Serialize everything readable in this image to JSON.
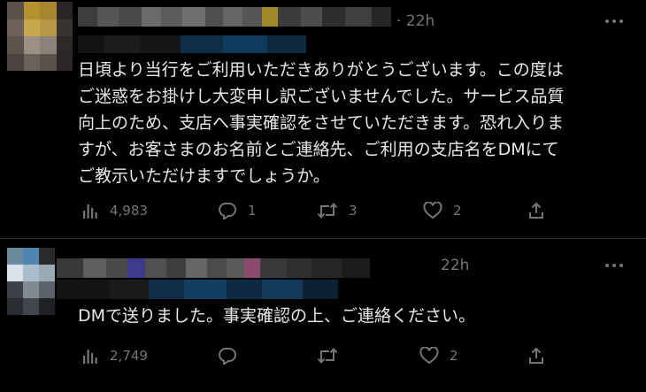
{
  "tweets": [
    {
      "timestamp": "· 22h",
      "text": "日頃より当行をご利用いただきありがとうございます。この度は\nご迷惑をお掛けし大変申し訳ございませんでした。サービス品質\n向上のため、支店へ事実確認をさせていただきます。恐れ入りま\nすが、お客さまのお名前とご連絡先、ご利用の支店名をDMにて\nご教示いただけますでしょうか。",
      "views": "4,983",
      "replies": "1",
      "retweets": "3",
      "likes": "2"
    },
    {
      "timestamp": "22h",
      "text": "DMで送りました。事実確認の上、ご連絡ください。",
      "views": "2,749",
      "replies": "",
      "retweets": "",
      "likes": "2"
    }
  ],
  "icons": {
    "views": "bar-chart-icon",
    "reply": "reply-bubble-icon",
    "retweet": "retweet-icon",
    "like": "heart-icon",
    "share": "share-icon",
    "more": "more-dots-icon"
  },
  "colors": {
    "background": "#000000",
    "text": "#e7e9ea",
    "muted": "#71767b",
    "divider": "#2f3336"
  }
}
